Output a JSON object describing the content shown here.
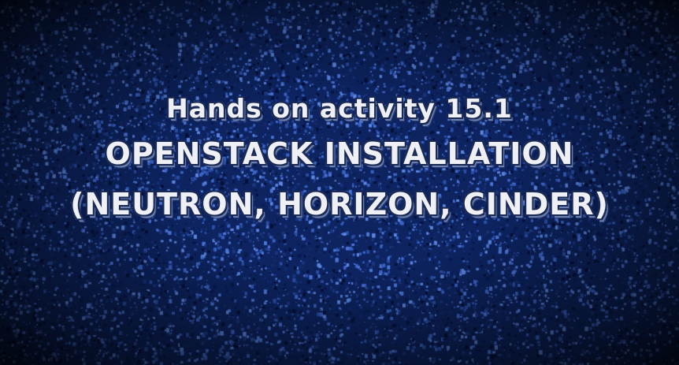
{
  "slide": {
    "line1": "Hands on activity 15.1",
    "line2": "OPENSTACK INSTALLATION",
    "line3": "(NEUTRON, HORIZON, CINDER)"
  },
  "colors": {
    "background": "#0d2460",
    "speckle_light": "#3a63c8",
    "speckle_dark": "#06113a",
    "text": "#eef0f6",
    "text_outline": "#1a2a55"
  }
}
